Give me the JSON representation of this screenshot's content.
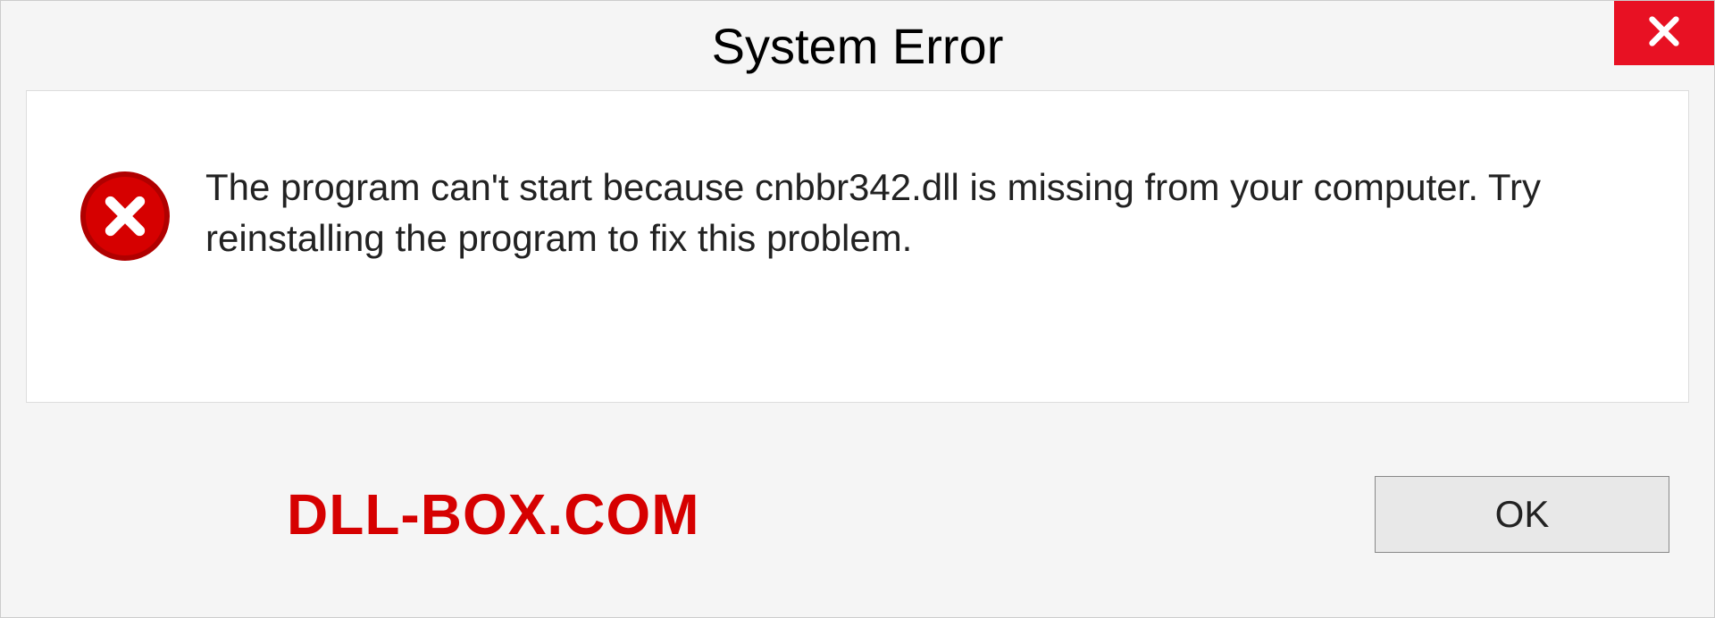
{
  "dialog": {
    "title": "System Error",
    "message": "The program can't start because cnbbr342.dll is missing from your computer. Try reinstalling the program to fix this problem.",
    "ok_label": "OK",
    "watermark": "DLL-BOX.COM"
  }
}
